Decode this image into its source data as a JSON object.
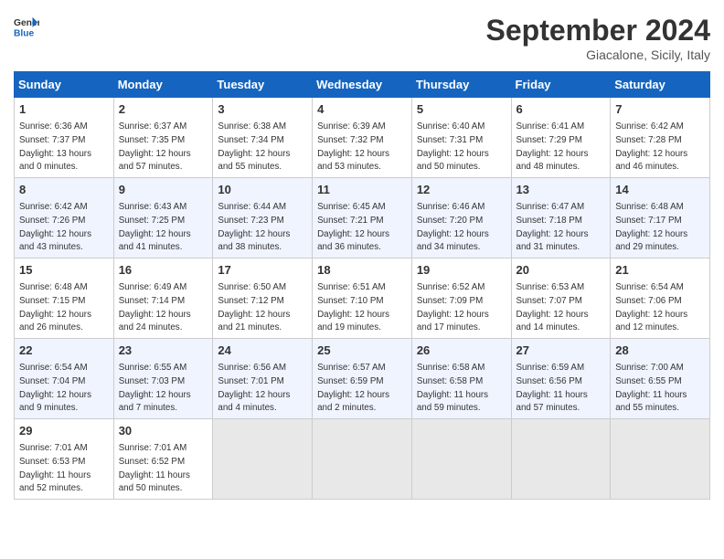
{
  "header": {
    "logo_general": "General",
    "logo_blue": "Blue",
    "month_title": "September 2024",
    "location": "Giacalone, Sicily, Italy"
  },
  "weekdays": [
    "Sunday",
    "Monday",
    "Tuesday",
    "Wednesday",
    "Thursday",
    "Friday",
    "Saturday"
  ],
  "weeks": [
    [
      {
        "day": "1",
        "info": "Sunrise: 6:36 AM\nSunset: 7:37 PM\nDaylight: 13 hours\nand 0 minutes."
      },
      {
        "day": "2",
        "info": "Sunrise: 6:37 AM\nSunset: 7:35 PM\nDaylight: 12 hours\nand 57 minutes."
      },
      {
        "day": "3",
        "info": "Sunrise: 6:38 AM\nSunset: 7:34 PM\nDaylight: 12 hours\nand 55 minutes."
      },
      {
        "day": "4",
        "info": "Sunrise: 6:39 AM\nSunset: 7:32 PM\nDaylight: 12 hours\nand 53 minutes."
      },
      {
        "day": "5",
        "info": "Sunrise: 6:40 AM\nSunset: 7:31 PM\nDaylight: 12 hours\nand 50 minutes."
      },
      {
        "day": "6",
        "info": "Sunrise: 6:41 AM\nSunset: 7:29 PM\nDaylight: 12 hours\nand 48 minutes."
      },
      {
        "day": "7",
        "info": "Sunrise: 6:42 AM\nSunset: 7:28 PM\nDaylight: 12 hours\nand 46 minutes."
      }
    ],
    [
      {
        "day": "8",
        "info": "Sunrise: 6:42 AM\nSunset: 7:26 PM\nDaylight: 12 hours\nand 43 minutes."
      },
      {
        "day": "9",
        "info": "Sunrise: 6:43 AM\nSunset: 7:25 PM\nDaylight: 12 hours\nand 41 minutes."
      },
      {
        "day": "10",
        "info": "Sunrise: 6:44 AM\nSunset: 7:23 PM\nDaylight: 12 hours\nand 38 minutes."
      },
      {
        "day": "11",
        "info": "Sunrise: 6:45 AM\nSunset: 7:21 PM\nDaylight: 12 hours\nand 36 minutes."
      },
      {
        "day": "12",
        "info": "Sunrise: 6:46 AM\nSunset: 7:20 PM\nDaylight: 12 hours\nand 34 minutes."
      },
      {
        "day": "13",
        "info": "Sunrise: 6:47 AM\nSunset: 7:18 PM\nDaylight: 12 hours\nand 31 minutes."
      },
      {
        "day": "14",
        "info": "Sunrise: 6:48 AM\nSunset: 7:17 PM\nDaylight: 12 hours\nand 29 minutes."
      }
    ],
    [
      {
        "day": "15",
        "info": "Sunrise: 6:48 AM\nSunset: 7:15 PM\nDaylight: 12 hours\nand 26 minutes."
      },
      {
        "day": "16",
        "info": "Sunrise: 6:49 AM\nSunset: 7:14 PM\nDaylight: 12 hours\nand 24 minutes."
      },
      {
        "day": "17",
        "info": "Sunrise: 6:50 AM\nSunset: 7:12 PM\nDaylight: 12 hours\nand 21 minutes."
      },
      {
        "day": "18",
        "info": "Sunrise: 6:51 AM\nSunset: 7:10 PM\nDaylight: 12 hours\nand 19 minutes."
      },
      {
        "day": "19",
        "info": "Sunrise: 6:52 AM\nSunset: 7:09 PM\nDaylight: 12 hours\nand 17 minutes."
      },
      {
        "day": "20",
        "info": "Sunrise: 6:53 AM\nSunset: 7:07 PM\nDaylight: 12 hours\nand 14 minutes."
      },
      {
        "day": "21",
        "info": "Sunrise: 6:54 AM\nSunset: 7:06 PM\nDaylight: 12 hours\nand 12 minutes."
      }
    ],
    [
      {
        "day": "22",
        "info": "Sunrise: 6:54 AM\nSunset: 7:04 PM\nDaylight: 12 hours\nand 9 minutes."
      },
      {
        "day": "23",
        "info": "Sunrise: 6:55 AM\nSunset: 7:03 PM\nDaylight: 12 hours\nand 7 minutes."
      },
      {
        "day": "24",
        "info": "Sunrise: 6:56 AM\nSunset: 7:01 PM\nDaylight: 12 hours\nand 4 minutes."
      },
      {
        "day": "25",
        "info": "Sunrise: 6:57 AM\nSunset: 6:59 PM\nDaylight: 12 hours\nand 2 minutes."
      },
      {
        "day": "26",
        "info": "Sunrise: 6:58 AM\nSunset: 6:58 PM\nDaylight: 11 hours\nand 59 minutes."
      },
      {
        "day": "27",
        "info": "Sunrise: 6:59 AM\nSunset: 6:56 PM\nDaylight: 11 hours\nand 57 minutes."
      },
      {
        "day": "28",
        "info": "Sunrise: 7:00 AM\nSunset: 6:55 PM\nDaylight: 11 hours\nand 55 minutes."
      }
    ],
    [
      {
        "day": "29",
        "info": "Sunrise: 7:01 AM\nSunset: 6:53 PM\nDaylight: 11 hours\nand 52 minutes."
      },
      {
        "day": "30",
        "info": "Sunrise: 7:01 AM\nSunset: 6:52 PM\nDaylight: 11 hours\nand 50 minutes."
      },
      {
        "day": "",
        "info": ""
      },
      {
        "day": "",
        "info": ""
      },
      {
        "day": "",
        "info": ""
      },
      {
        "day": "",
        "info": ""
      },
      {
        "day": "",
        "info": ""
      }
    ]
  ]
}
